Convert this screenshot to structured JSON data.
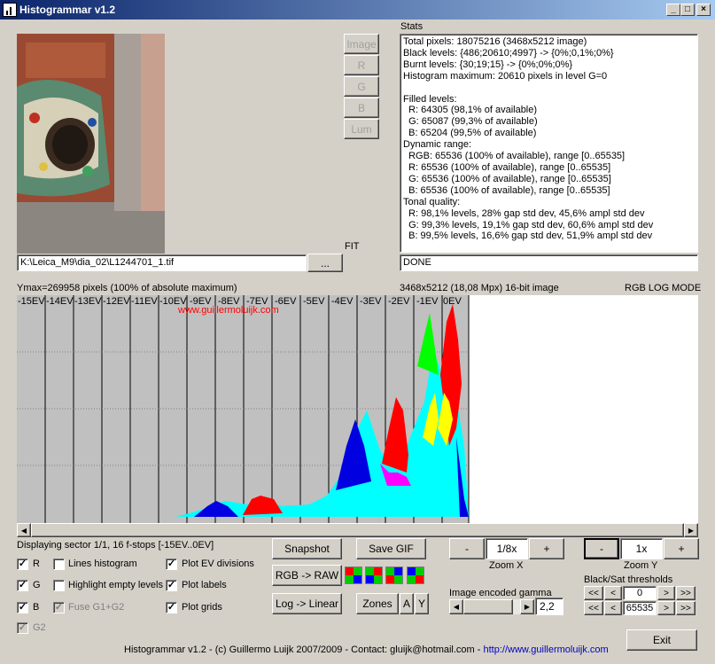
{
  "window": {
    "title": "Histogrammar v1.2",
    "min": "_",
    "max": "□",
    "close": "×"
  },
  "side_buttons": [
    "Image",
    "R",
    "G",
    "B",
    "Lum"
  ],
  "fit_label": "FIT",
  "file_path": "K:\\Leica_M9\\dia_02\\L1244701_1.tif",
  "browse_label": "...",
  "stats_title": "Stats",
  "stats_text": "Total pixels: 18075216 (3468x5212 image)\nBlack levels: {486;20610;4997} -> {0%;0,1%;0%}\nBurnt levels: {30;19;15} -> {0%;0%;0%}\nHistogram maximum: 20610 pixels in level G=0\n\nFilled levels:\n  R: 64305 (98,1% of available)\n  G: 65087 (99,3% of available)\n  B: 65204 (99,5% of available)\nDynamic range:\n  RGB: 65536 (100% of available), range [0..65535]\n  R: 65536 (100% of available), range [0..65535]\n  G: 65536 (100% of available), range [0..65535]\n  B: 65536 (100% of available), range [0..65535]\nTonal quality:\n  R: 98,1% levels, 28% gap std dev, 45,6% ampl std dev\n  G: 99,3% levels, 19,1% gap std dev, 60,6% ampl std dev\n  B: 99,5% levels, 16,6% gap std dev, 51,9% ampl std dev",
  "status": "DONE",
  "ymax_text": "Ymax=269958 pixels (100% of absolute maximum)",
  "image_info": "3468x5212 (18,08 Mpx) 16-bit image",
  "mode": "RGB LOG MODE",
  "ev_labels": [
    "-15EV",
    "-14EV",
    "-13EV",
    "-12EV",
    "-11EV",
    "-10EV",
    "-9EV",
    "-8EV",
    "-7EV",
    "-6EV",
    "-5EV",
    "-4EV",
    "-3EV",
    "-2EV",
    "-1EV",
    "0EV"
  ],
  "watermark": "www.guillermoluijk.com",
  "sector_text": "Displaying sector 1/1, 16 f-stops [-15EV..0EV]",
  "checks": {
    "r": {
      "label": "R",
      "checked": true
    },
    "g": {
      "label": "G",
      "checked": true
    },
    "b": {
      "label": "B",
      "checked": true
    },
    "g2": {
      "label": "G2",
      "checked": true,
      "disabled": true
    },
    "lines": {
      "label": "Lines histogram",
      "checked": false
    },
    "highlight": {
      "label": "Highlight empty levels",
      "checked": false
    },
    "fuse": {
      "label": "Fuse G1+G2",
      "checked": true,
      "disabled": true
    },
    "ev_div": {
      "label": "Plot EV divisions",
      "checked": true
    },
    "labels": {
      "label": "Plot labels",
      "checked": true
    },
    "grids": {
      "label": "Plot grids",
      "checked": true
    }
  },
  "buttons": {
    "snapshot": "Snapshot",
    "save_gif": "Save GIF",
    "rgb_raw": "RGB -> RAW",
    "log_linear": "Log -> Linear",
    "zones": "Zones",
    "a": "A",
    "y": "Y",
    "exit": "Exit"
  },
  "zoom_x": {
    "value": "1/8x",
    "label": "Zoom X",
    "minus": "-",
    "plus": "+"
  },
  "zoom_y": {
    "value": "1x",
    "label": "Zoom Y",
    "minus": "-",
    "plus": "+"
  },
  "gamma": {
    "label": "Image encoded gamma",
    "value": "2,2"
  },
  "thresholds": {
    "label": "Black/Sat thresholds",
    "black": "0",
    "sat": "65535",
    "dbl_left": "<<",
    "left": "<",
    "right": ">",
    "dbl_right": ">>"
  },
  "footer": {
    "text": "Histogrammar v1.2 - (c) Guillermo Luijk 2007/2009 - Contact: gluijk@hotmail.com - ",
    "link": "http://www.guillermoluijk.com"
  },
  "colors": {
    "title_start": "#0a246a",
    "title_end": "#a6caf0",
    "red": "#ff0000",
    "green": "#00ff00",
    "blue": "#0000e0",
    "yellow": "#ffff00",
    "cyan": "#00ffff",
    "magenta": "#ff00ff",
    "link": "#0000c0"
  },
  "icons": {
    "app": "histogram-app-icon",
    "scroll_left": "arrow-left-icon",
    "scroll_right": "arrow-right-icon"
  }
}
